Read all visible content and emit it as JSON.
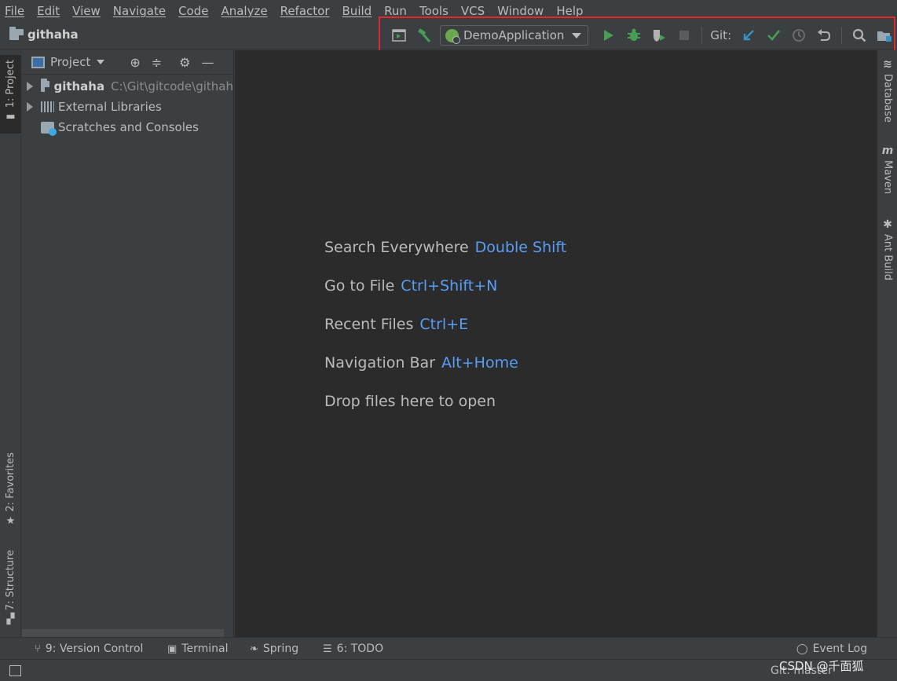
{
  "menu": [
    "File",
    "Edit",
    "View",
    "Navigate",
    "Code",
    "Analyze",
    "Refactor",
    "Build",
    "Run",
    "Tools",
    "VCS",
    "Window",
    "Help"
  ],
  "nav": {
    "project_name": "githaha"
  },
  "toolbar": {
    "run_config": "DemoApplication",
    "git_label": "Git:",
    "colors": {
      "run": "#499c54",
      "update": "#3592c4",
      "commit": "#499c54",
      "history": "#6e6e6e"
    }
  },
  "left_tabs": {
    "project": "1: Project",
    "favorites": "2: Favorites",
    "structure": "7: Structure"
  },
  "project_panel": {
    "title": "Project",
    "tree": [
      {
        "label": "githaha",
        "path": "C:\\Git\\gitcode\\githah"
      },
      {
        "label": "External Libraries"
      },
      {
        "label": "Scratches and Consoles"
      }
    ]
  },
  "editor": {
    "hints": [
      {
        "label": "Search Everywhere",
        "key": "Double Shift"
      },
      {
        "label": "Go to File",
        "key": "Ctrl+Shift+N"
      },
      {
        "label": "Recent Files",
        "key": "Ctrl+E"
      },
      {
        "label": "Navigation Bar",
        "key": "Alt+Home"
      },
      {
        "label": "Drop files here to open",
        "key": ""
      }
    ]
  },
  "right_tabs": {
    "database": "Database",
    "maven_glyph": "m",
    "maven": "Maven",
    "ant": "Ant Build"
  },
  "bottom_tabs": {
    "version_control": "9: Version Control",
    "terminal": "Terminal",
    "spring": "Spring",
    "todo": "6: TODO",
    "event_log": "Event Log"
  },
  "status": {
    "git_branch": "Git: master",
    "watermark": "CSDN @千面狐"
  }
}
